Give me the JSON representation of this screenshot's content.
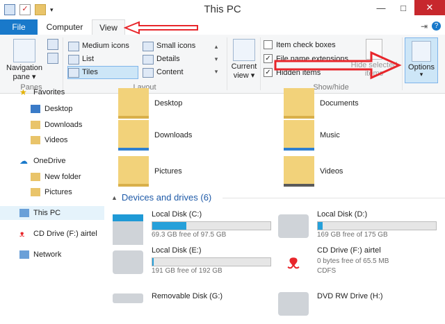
{
  "window": {
    "title": "This PC"
  },
  "tabs": {
    "file": "File",
    "computer": "Computer",
    "view": "View"
  },
  "ribbon": {
    "panes": {
      "nav_label1": "Navigation",
      "nav_label2": "pane ▾",
      "group": "Panes"
    },
    "layout": {
      "items": [
        "Medium icons",
        "Small icons",
        "List",
        "Details",
        "Tiles",
        "Content"
      ],
      "selected": "Tiles",
      "group": "Layout"
    },
    "current_view": {
      "label1": "Current",
      "label2": "view ▾"
    },
    "show_hide": {
      "item_check_boxes": "Item check boxes",
      "file_name_extensions": "File name extensions",
      "hidden_items": "Hidden items",
      "hide_selected_1": "Hide selected",
      "hide_selected_2": "items",
      "group": "Show/hide"
    },
    "options": {
      "label": "Options",
      "sub": "▾"
    }
  },
  "nav": {
    "items": [
      "Favorites",
      "Desktop",
      "Downloads",
      "Videos",
      "OneDrive",
      "New folder",
      "Pictures",
      "This PC",
      "CD Drive (F:) airtel",
      "Network"
    ]
  },
  "folders": [
    "Desktop",
    "Documents",
    "Downloads",
    "Music",
    "Pictures",
    "Videos"
  ],
  "devices": {
    "heading": "Devices and drives (6)"
  },
  "drives": [
    {
      "name": "Local Disk (C:)",
      "free": "69.3 GB free of 97.5 GB",
      "used_fraction": 0.29
    },
    {
      "name": "Local Disk (D:)",
      "free": "169 GB free of 175 GB",
      "used_fraction": 0.04
    },
    {
      "name": "Local Disk (E:)",
      "free": "191 GB free of 192 GB",
      "used_fraction": 0.01
    },
    {
      "name": "CD Drive (F:) airtel",
      "free": "0 bytes free of 65.5 MB",
      "fs": "CDFS"
    },
    {
      "name": "Removable Disk (G:)"
    },
    {
      "name": "DVD RW Drive (H:)"
    }
  ],
  "colors": {
    "accent": "#1979ca",
    "annotation": "#e8262b",
    "bar": "#26a0da"
  }
}
